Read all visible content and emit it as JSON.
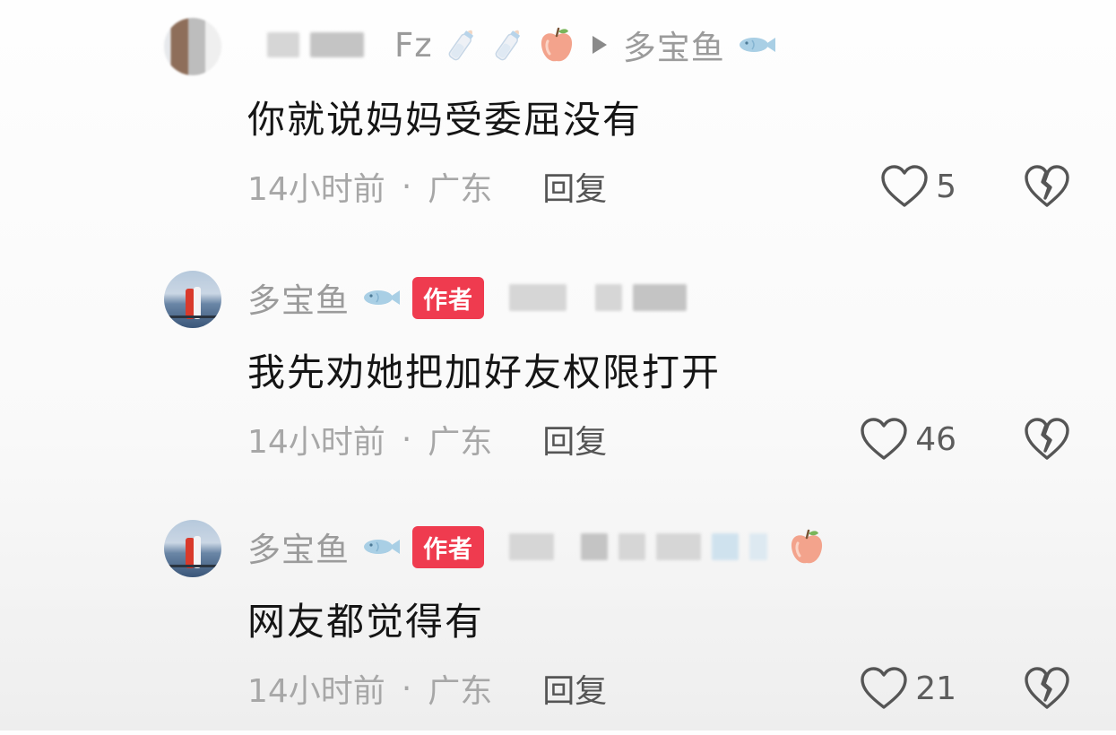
{
  "comments": [
    {
      "author_suffix": "Fz",
      "reply_to": "多宝鱼",
      "text": "你就说妈妈受委屈没有",
      "time": "14小时前",
      "location": "广东",
      "separator": "·",
      "reply_label": "回复",
      "likes": "5"
    },
    {
      "author": "多宝鱼",
      "badge": "作者",
      "text": "我先劝她把加好友权限打开",
      "time": "14小时前",
      "location": "广东",
      "separator": "·",
      "reply_label": "回复",
      "likes": "46"
    },
    {
      "author": "多宝鱼",
      "badge": "作者",
      "text": "网友都觉得有",
      "time": "14小时前",
      "location": "广东",
      "separator": "·",
      "reply_label": "回复",
      "likes": "21"
    }
  ],
  "colors": {
    "badge_bg": "#ef3b4f",
    "meta_text": "#a7a7a7",
    "name_text": "#9b9b9b"
  }
}
